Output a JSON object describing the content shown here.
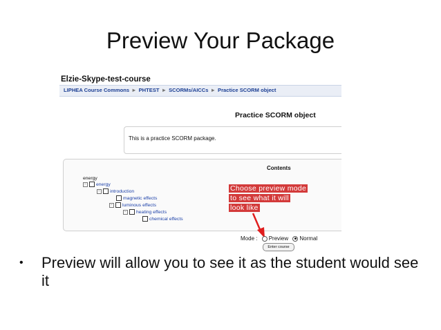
{
  "slide": {
    "title": "Preview Your Package",
    "bullet": "Preview will allow you to see it as the student would see it"
  },
  "screenshot": {
    "course_name": "Elzie-Skype-test-course",
    "breadcrumbs": [
      "LIPHEA Course Commons",
      "PHTEST",
      "SCORMs/AICCs",
      "Practice SCORM object"
    ],
    "breadcrumb_separator": "►",
    "object_title": "Practice SCORM object",
    "intro_text": "This is a practice SCORM package.",
    "contents_label": "Contents",
    "toc": {
      "root": "energy",
      "energy": "energy",
      "introduction": "introduction",
      "magnetic_effects": "magnetic effects",
      "luminous_effects": "luminous effects",
      "heating_effects": "heating effects",
      "chemical_effects": "chemical effects"
    },
    "callout_lines": [
      "Choose preview mode",
      "to see what it will",
      "look like"
    ],
    "callout_color": "#d33a3a",
    "mode_label": "Mode :",
    "mode_options": [
      {
        "label": "Preview",
        "selected": false
      },
      {
        "label": "Normal",
        "selected": true
      }
    ],
    "enter_button": "Enter course"
  }
}
